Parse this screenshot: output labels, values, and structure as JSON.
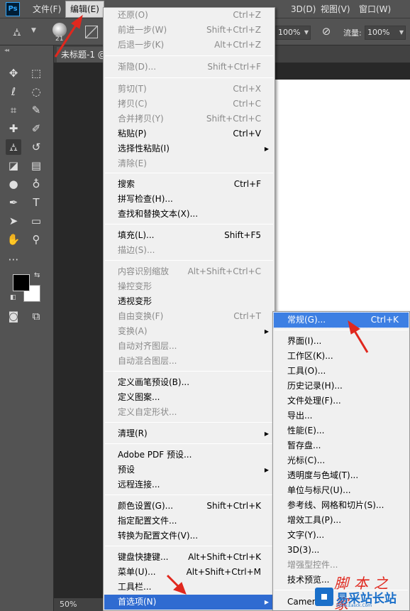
{
  "app": {
    "logo": "Ps"
  },
  "menubar": {
    "file": "文件(F)",
    "edit": "编辑(E)",
    "threed": "3D(D)",
    "view": "视图(V)",
    "window": "窗口(W)"
  },
  "options": {
    "brush_size": "21",
    "opacity": "100%",
    "flow_label": "流量:",
    "flow": "100%"
  },
  "document": {
    "tab": "未标题-1 @",
    "zoom": "50%"
  },
  "edit_menu": {
    "items": [
      {
        "label": "还原(O)",
        "shortcut": "Ctrl+Z",
        "disabled": true
      },
      {
        "label": "前进一步(W)",
        "shortcut": "Shift+Ctrl+Z",
        "disabled": true
      },
      {
        "label": "后退一步(K)",
        "shortcut": "Alt+Ctrl+Z",
        "disabled": true
      },
      {
        "label": "渐隐(D)...",
        "shortcut": "Shift+Ctrl+F",
        "disabled": true
      },
      {
        "label": "剪切(T)",
        "shortcut": "Ctrl+X",
        "disabled": true
      },
      {
        "label": "拷贝(C)",
        "shortcut": "Ctrl+C",
        "disabled": true
      },
      {
        "label": "合并拷贝(Y)",
        "shortcut": "Shift+Ctrl+C",
        "disabled": true
      },
      {
        "label": "粘贴(P)",
        "shortcut": "Ctrl+V",
        "disabled": false
      },
      {
        "label": "选择性粘贴(I)",
        "shortcut": "",
        "disabled": false,
        "submenu": true
      },
      {
        "label": "清除(E)",
        "shortcut": "",
        "disabled": true
      },
      {
        "label": "搜索",
        "shortcut": "Ctrl+F",
        "disabled": false
      },
      {
        "label": "拼写检查(H)...",
        "shortcut": "",
        "disabled": false
      },
      {
        "label": "查找和替换文本(X)...",
        "shortcut": "",
        "disabled": false
      },
      {
        "label": "填充(L)...",
        "shortcut": "Shift+F5",
        "disabled": false
      },
      {
        "label": "描边(S)...",
        "shortcut": "",
        "disabled": true
      },
      {
        "label": "内容识别缩放",
        "shortcut": "Alt+Shift+Ctrl+C",
        "disabled": true
      },
      {
        "label": "操控变形",
        "shortcut": "",
        "disabled": true
      },
      {
        "label": "透视变形",
        "shortcut": "",
        "disabled": false
      },
      {
        "label": "自由变换(F)",
        "shortcut": "Ctrl+T",
        "disabled": true
      },
      {
        "label": "变换(A)",
        "shortcut": "",
        "disabled": true,
        "submenu": true
      },
      {
        "label": "自动对齐图层...",
        "shortcut": "",
        "disabled": true
      },
      {
        "label": "自动混合图层...",
        "shortcut": "",
        "disabled": true
      },
      {
        "label": "定义画笔预设(B)...",
        "shortcut": "",
        "disabled": false
      },
      {
        "label": "定义图案...",
        "shortcut": "",
        "disabled": false
      },
      {
        "label": "定义自定形状...",
        "shortcut": "",
        "disabled": true
      },
      {
        "label": "清理(R)",
        "shortcut": "",
        "disabled": false,
        "submenu": true
      },
      {
        "label": "Adobe PDF 预设...",
        "shortcut": "",
        "disabled": false
      },
      {
        "label": "预设",
        "shortcut": "",
        "disabled": false,
        "submenu": true
      },
      {
        "label": "远程连接...",
        "shortcut": "",
        "disabled": false
      },
      {
        "label": "颜色设置(G)...",
        "shortcut": "Shift+Ctrl+K",
        "disabled": false
      },
      {
        "label": "指定配置文件...",
        "shortcut": "",
        "disabled": false
      },
      {
        "label": "转换为配置文件(V)...",
        "shortcut": "",
        "disabled": false
      },
      {
        "label": "键盘快捷键...",
        "shortcut": "Alt+Shift+Ctrl+K",
        "disabled": false
      },
      {
        "label": "菜单(U)...",
        "shortcut": "Alt+Shift+Ctrl+M",
        "disabled": false
      },
      {
        "label": "工具栏...",
        "shortcut": "",
        "disabled": false
      },
      {
        "label": "首选项(N)",
        "shortcut": "",
        "disabled": false,
        "submenu": true,
        "highlighted": true
      }
    ]
  },
  "preferences_menu": {
    "items": [
      {
        "label": "常规(G)...",
        "shortcut": "Ctrl+K",
        "disabled": false,
        "highlighted": true
      },
      {
        "label": "界面(I)...",
        "shortcut": "",
        "disabled": false
      },
      {
        "label": "工作区(K)...",
        "shortcut": "",
        "disabled": false
      },
      {
        "label": "工具(O)...",
        "shortcut": "",
        "disabled": false
      },
      {
        "label": "历史记录(H)...",
        "shortcut": "",
        "disabled": false
      },
      {
        "label": "文件处理(F)...",
        "shortcut": "",
        "disabled": false
      },
      {
        "label": "导出...",
        "shortcut": "",
        "disabled": false
      },
      {
        "label": "性能(E)...",
        "shortcut": "",
        "disabled": false
      },
      {
        "label": "暂存盘...",
        "shortcut": "",
        "disabled": false
      },
      {
        "label": "光标(C)...",
        "shortcut": "",
        "disabled": false
      },
      {
        "label": "透明度与色域(T)...",
        "shortcut": "",
        "disabled": false
      },
      {
        "label": "单位与标尺(U)...",
        "shortcut": "",
        "disabled": false
      },
      {
        "label": "参考线、网格和切片(S)...",
        "shortcut": "",
        "disabled": false
      },
      {
        "label": "增效工具(P)...",
        "shortcut": "",
        "disabled": false
      },
      {
        "label": "文字(Y)...",
        "shortcut": "",
        "disabled": false
      },
      {
        "label": "3D(3)...",
        "shortcut": "",
        "disabled": false
      },
      {
        "label": "增强型控件...",
        "shortcut": "",
        "disabled": true
      },
      {
        "label": "技术预览...",
        "shortcut": "",
        "disabled": false
      },
      {
        "label": "Camer",
        "shortcut": "",
        "disabled": false
      }
    ]
  },
  "watermark": {
    "top": "脚本之家",
    "name": "易采站长站",
    "url": "Www.Easck.Com"
  },
  "colors": {
    "accent": "#2f6bd1",
    "annotation": "#e0281e"
  }
}
